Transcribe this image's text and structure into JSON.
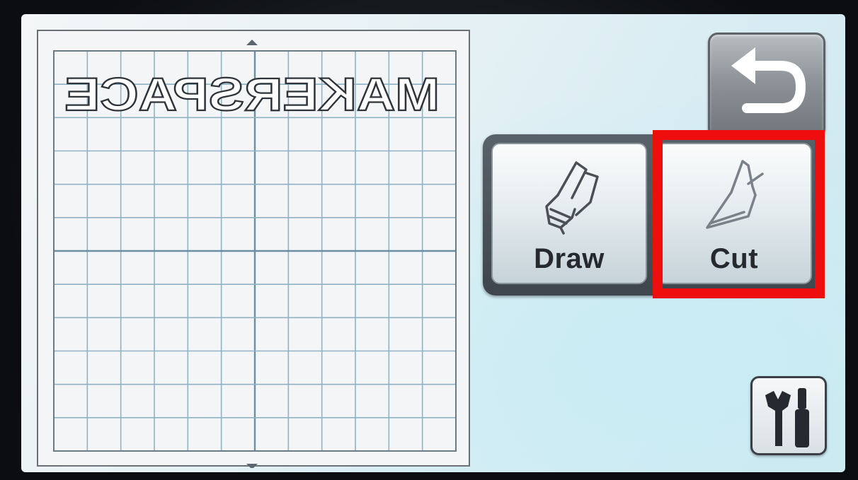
{
  "screen": {
    "mat_text": "MAKERSPACE",
    "mat_text_mirrored": true,
    "mat_grid": {
      "columns": 12,
      "rows": 12
    },
    "mat_indicators": [
      "arrow-up-icon",
      "arrow-down-icon"
    ]
  },
  "buttons": {
    "back": {
      "icon": "return-arrow-icon"
    },
    "draw": {
      "label": "Draw",
      "icon": "pen-icon"
    },
    "cut": {
      "label": "Cut",
      "icon": "blade-icon",
      "highlighted": true
    },
    "settings": {
      "icon": "wrench-screwdriver-icon"
    }
  },
  "colors": {
    "highlight": "#ee0e0e",
    "grid_line": "#8fb2c4",
    "label": "#262a2e"
  }
}
